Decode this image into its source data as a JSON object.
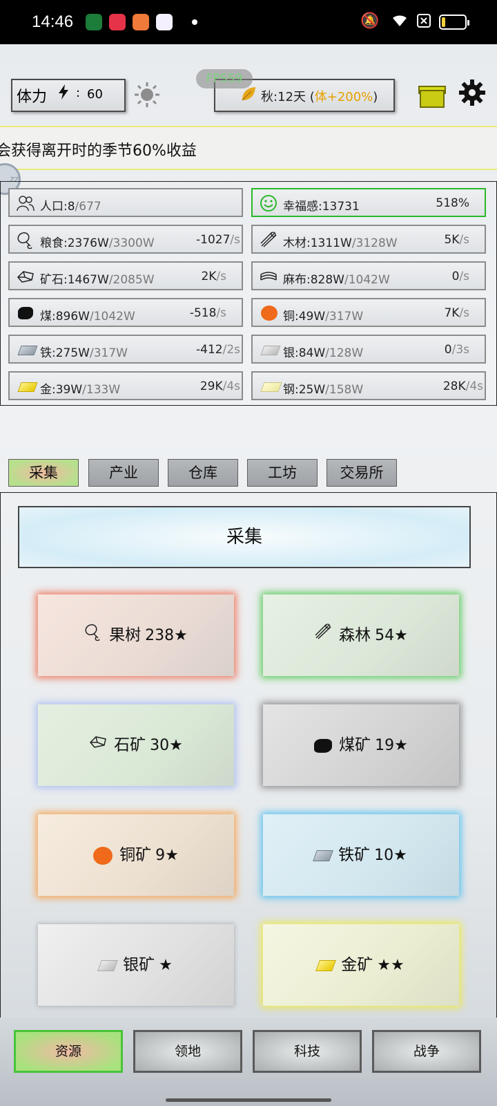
{
  "status_bar": {
    "time": "14:46",
    "app_icons": [
      "oppo-app-icon",
      "video-app-icon",
      "reader-app-icon",
      "gallery-app-icon"
    ],
    "right_icons": [
      "mute-icon",
      "wifi-icon",
      "sim-off-icon",
      "battery-icon"
    ]
  },
  "top": {
    "stamina_label": "体力",
    "stamina_value": "60",
    "colon": ":",
    "fps_label": "FPS59",
    "season_text": "秋:12天",
    "season_paren_open": "(",
    "season_bonus": "体+200%",
    "season_paren_close": ")"
  },
  "notice": {
    "text": "会获得离开时的季节60%收益"
  },
  "floating_bubble": "zz",
  "resources": [
    {
      "icon": "people-icon",
      "name": "人口:8",
      "cap": "/677",
      "rate": "",
      "unit": ""
    },
    {
      "icon": "smile-icon",
      "name": "幸福感:13731",
      "cap": "",
      "rate": "518%",
      "unit": ""
    },
    {
      "icon": "food-icon",
      "name": "粮食:2376W",
      "cap": "/3300W",
      "rate": "-1027",
      "unit": "/s"
    },
    {
      "icon": "wood-icon",
      "name": "木材:1311W",
      "cap": "/3128W",
      "rate": "5K",
      "unit": "/s"
    },
    {
      "icon": "ore-icon",
      "name": "矿石:1467W",
      "cap": "/2085W",
      "rate": "2K",
      "unit": "/s"
    },
    {
      "icon": "cloth-icon",
      "name": "麻布:828W",
      "cap": "/1042W",
      "rate": "0",
      "unit": "/s"
    },
    {
      "icon": "coal-icon",
      "name": "煤:896W",
      "cap": "/1042W",
      "rate": "-518",
      "unit": "/s"
    },
    {
      "icon": "copper-icon",
      "name": "铜:49W",
      "cap": "/317W",
      "rate": "7K",
      "unit": "/s"
    },
    {
      "icon": "iron-icon",
      "name": "铁:275W",
      "cap": "/317W",
      "rate": "-412",
      "unit": "/2s"
    },
    {
      "icon": "silver-icon",
      "name": "银:84W",
      "cap": "/128W",
      "rate": "0",
      "unit": "/3s"
    },
    {
      "icon": "gold-icon",
      "name": "金:39W",
      "cap": "/133W",
      "rate": "29K",
      "unit": "/4s"
    },
    {
      "icon": "steel-icon",
      "name": "钢:25W",
      "cap": "/158W",
      "rate": "28K",
      "unit": "/4s"
    }
  ],
  "tabs": [
    "采集",
    "产业",
    "仓库",
    "工坊",
    "交易所"
  ],
  "active_tab": "采集",
  "panel_title": "采集",
  "tiles": [
    {
      "icon": "food-icon",
      "label": "果树",
      "stars": "238★",
      "glow": "red"
    },
    {
      "icon": "wood-icon",
      "label": "森林",
      "stars": "54★",
      "glow": "green"
    },
    {
      "icon": "ore-icon",
      "label": "石矿",
      "stars": "30★",
      "glow": "blue"
    },
    {
      "icon": "coal-icon",
      "label": "煤矿",
      "stars": "19★",
      "glow": "gray"
    },
    {
      "icon": "copper-icon",
      "label": "铜矿",
      "stars": "9★",
      "glow": "orange"
    },
    {
      "icon": "iron-icon",
      "label": "铁矿",
      "stars": "10★",
      "glow": "cyan"
    },
    {
      "icon": "silver-icon",
      "label": "银矿",
      "stars": "★",
      "glow": "none"
    },
    {
      "icon": "gold-icon",
      "label": "金矿",
      "stars": "★★",
      "glow": "yellow"
    }
  ],
  "bottom_nav": [
    "资源",
    "领地",
    "科技",
    "战争"
  ],
  "active_bottom": "资源",
  "colors": {
    "fps_text": "#7ad27a",
    "season_bonus": "#e8a100",
    "happy_border": "#29b829",
    "active_tab_green": "#b7e08e",
    "active_nav_border": "#49c33b",
    "gift": "#c9cc12"
  }
}
